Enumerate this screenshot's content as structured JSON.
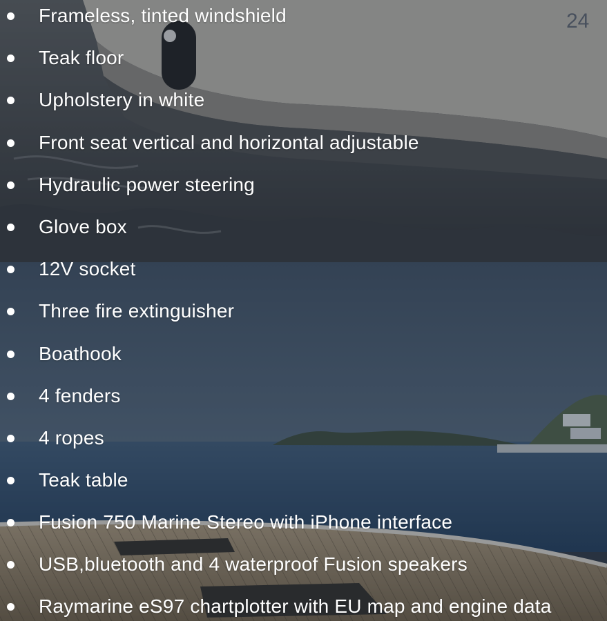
{
  "features": [
    "Frameless, tinted windshield",
    "Teak floor",
    "Upholstery in white",
    "Front seat vertical and horizontal adjustable",
    "Hydraulic power steering",
    "Glove box",
    "12V socket",
    "Three fire extinguisher",
    "Boathook",
    "4 fenders",
    "4 ropes",
    "Teak table",
    "Fusion 750 Marine Stereo with iPhone interface",
    "USB,bluetooth and 4 waterproof Fusion speakers",
    "Raymarine eS97 chartplotter with EU map and engine data"
  ],
  "hull_number": "24",
  "colors": {
    "text": "#ffffff",
    "water_top": "#3a3f44",
    "sky": "#3f5164",
    "sea": "#2d4863",
    "deck": "#8d7c62"
  }
}
